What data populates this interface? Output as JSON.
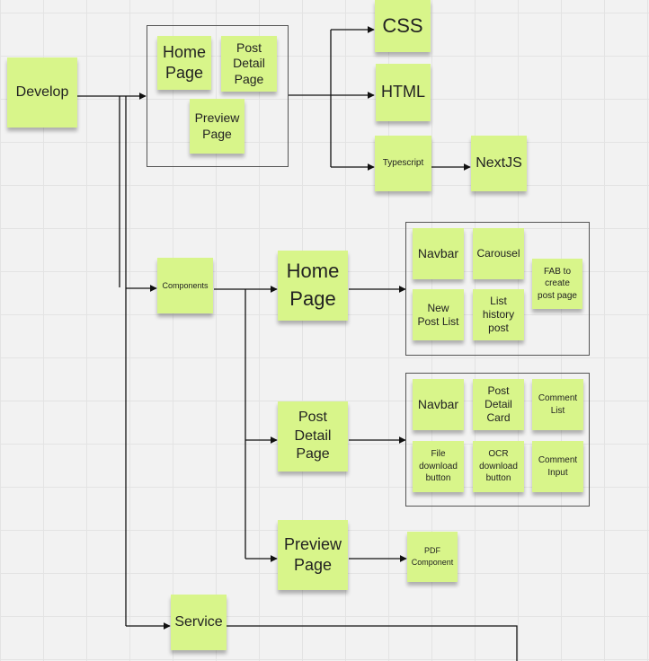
{
  "notes": {
    "develop": "Develop",
    "home_page": "Home\nPage",
    "post_detail_page": "Post\nDetail\nPage",
    "preview_page": "Preview\nPage",
    "css": "CSS",
    "html": "HTML",
    "typescript": "Typescript",
    "nextjs": "NextJS",
    "components": "Components",
    "components_home_page": "Home\nPage",
    "home_navbar": "Navbar",
    "home_carousel": "Carousel",
    "home_fab": "FAB to\ncreate\npost page",
    "home_new_post_list": "New\nPost List",
    "home_list_history_post": "List\nhistory\npost",
    "components_post_detail_page": "Post\nDetail\nPage",
    "detail_navbar": "Navbar",
    "detail_post_detail_card": "Post\nDetail\nCard",
    "detail_comment_list": "Comment\nList",
    "detail_file_download_button": "File\ndownload\nbutton",
    "detail_ocr_download_button": "OCR\ndownload\nbutton",
    "detail_comment_input": "Comment\nInput",
    "components_preview_page": "Preview\nPage",
    "pdf_component": "PDF\nComponent",
    "service": "Service"
  },
  "colors": {
    "sticky_note": "#d8f58a",
    "connector": "#111111",
    "group_frame": "#555555",
    "board_background": "#f2f2f2",
    "grid_line": "#e3e3e3"
  }
}
